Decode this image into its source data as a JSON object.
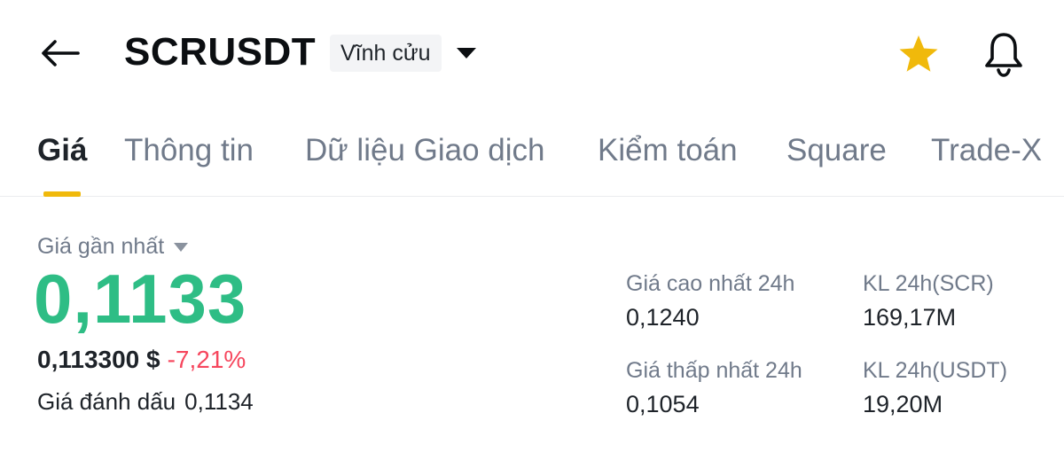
{
  "header": {
    "title": "SCRUSDT",
    "badge": "Vĩnh cửu",
    "icons": [
      "back-arrow-icon",
      "chevron-down-icon",
      "star-icon",
      "bell-icon"
    ],
    "favorite_color": "#F0B90B"
  },
  "tabs": [
    {
      "label": "Giá",
      "active": true
    },
    {
      "label": "Thông tin",
      "active": false
    },
    {
      "label": "Dữ liệu Giao dịch",
      "active": false
    },
    {
      "label": "Kiểm toán",
      "active": false
    },
    {
      "label": "Square",
      "active": false
    },
    {
      "label": "Trade-X",
      "active": false
    }
  ],
  "price": {
    "label": "Giá gần nhất",
    "last": "0,1133",
    "usd": "0,113300 $",
    "change": "-7,21%",
    "mark_label": "Giá đánh dấu",
    "mark_value": "0,1134",
    "up_color": "#2EBD85",
    "down_color": "#F6465D"
  },
  "stats": {
    "high": {
      "label": "Giá cao nhất 24h",
      "value": "0,1240"
    },
    "low": {
      "label": "Giá thấp nhất 24h",
      "value": "0,1054"
    },
    "vol_base": {
      "label": "KL 24h(SCR)",
      "value": "169,17M"
    },
    "vol_quote": {
      "label": "KL 24h(USDT)",
      "value": "19,20M"
    }
  }
}
